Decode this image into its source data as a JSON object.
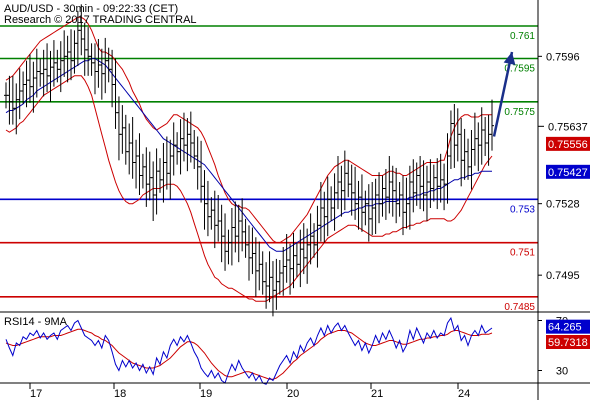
{
  "header": {
    "line1": "AUD/USD - 30min - 09:22:33 (CET)",
    "line2": "Research © 2017 TRADING CENTRAL"
  },
  "rsi_title": "RSI14 - 9MA",
  "colors": {
    "price": "#000000",
    "bollinger": "#cc0000",
    "ma": "#0000aa",
    "resistance": "#008000",
    "support": "#cc0000",
    "pivot": "#0000cc",
    "arrow": "#1a2f8a",
    "rsi": "#0000cc",
    "rsi_ma": "#cc0000"
  },
  "chart_data": [
    {
      "type": "candlestick",
      "x_ticks": [
        "17",
        "18",
        "19",
        "20",
        "21",
        "24"
      ],
      "y_ticks": [
        "0.7596",
        "0.7528",
        "0.7495"
      ],
      "ylim": [
        0.7478,
        0.7622
      ],
      "levels": [
        {
          "label": "0.761",
          "value": 0.761,
          "kind": "resistance"
        },
        {
          "label": "0.7595",
          "value": 0.7595,
          "kind": "resistance"
        },
        {
          "label": "0.7575",
          "value": 0.7575,
          "kind": "resistance"
        },
        {
          "label": "0.753",
          "value": 0.753,
          "kind": "pivot"
        },
        {
          "label": "0.751",
          "value": 0.751,
          "kind": "support"
        },
        {
          "label": "0.7485",
          "value": 0.7485,
          "kind": "support"
        }
      ],
      "value_tags": [
        {
          "label": "0.75637",
          "value": 0.75637,
          "kind": "price"
        },
        {
          "label": "0.75556",
          "value": 0.75556,
          "kind": "bollinger"
        },
        {
          "label": "0.75427",
          "value": 0.75427,
          "kind": "ma"
        }
      ],
      "close": [
        0.7578,
        0.7575,
        0.7572,
        0.7576,
        0.758,
        0.7583,
        0.7585,
        0.7582,
        0.7586,
        0.7589,
        0.7588,
        0.759,
        0.7587,
        0.7591,
        0.7593,
        0.759,
        0.7594,
        0.7596,
        0.7598,
        0.7594,
        0.7602,
        0.7608,
        0.7604,
        0.7599,
        0.7596,
        0.7593,
        0.7589,
        0.7592,
        0.7588,
        0.7594,
        0.759,
        0.7583,
        0.757,
        0.756,
        0.7563,
        0.7552,
        0.7556,
        0.7547,
        0.755,
        0.7541,
        0.7545,
        0.7537,
        0.754,
        0.7532,
        0.7543,
        0.7539,
        0.7547,
        0.7542,
        0.755,
        0.7555,
        0.7552,
        0.7558,
        0.7555,
        0.756,
        0.7556,
        0.755,
        0.7545,
        0.7536,
        0.7528,
        0.7522,
        0.7525,
        0.7518,
        0.752,
        0.7513,
        0.7506,
        0.751,
        0.7517,
        0.7513,
        0.752,
        0.7515,
        0.7509,
        0.7503,
        0.7505,
        0.7497,
        0.75,
        0.7492,
        0.749,
        0.7494,
        0.7488,
        0.7492,
        0.7496,
        0.7499,
        0.7502,
        0.7498,
        0.7504,
        0.75,
        0.7507,
        0.7503,
        0.7509,
        0.7513,
        0.7509,
        0.7518,
        0.7526,
        0.7522,
        0.753,
        0.7526,
        0.7533,
        0.7538,
        0.7534,
        0.7542,
        0.7537,
        0.7533,
        0.7528,
        0.7531,
        0.7524,
        0.7528,
        0.7521,
        0.7526,
        0.7532,
        0.7528,
        0.7535,
        0.7531,
        0.7538,
        0.7534,
        0.7528,
        0.7532,
        0.7524,
        0.7528,
        0.7538,
        0.7533,
        0.7541,
        0.7536,
        0.7532,
        0.7538,
        0.7535,
        0.754,
        0.7536,
        0.7539,
        0.7537,
        0.755,
        0.7565,
        0.7555,
        0.756,
        0.7548,
        0.7552,
        0.7545,
        0.7553,
        0.7558,
        0.7555,
        0.7562,
        0.7556,
        0.756,
        0.7564
      ],
      "ma": [
        0.757,
        0.7571,
        0.7571,
        0.7572,
        0.7573,
        0.7574,
        0.7576,
        0.7577,
        0.7578,
        0.758,
        0.7581,
        0.7582,
        0.7583,
        0.7584,
        0.7585,
        0.7586,
        0.7587,
        0.7588,
        0.7589,
        0.759,
        0.7591,
        0.7592,
        0.7593,
        0.7594,
        0.7594,
        0.7595,
        0.7595,
        0.7594,
        0.7593,
        0.7592,
        0.759,
        0.7588,
        0.7586,
        0.7584,
        0.7582,
        0.758,
        0.7578,
        0.7576,
        0.7574,
        0.7572,
        0.757,
        0.7568,
        0.7566,
        0.7564,
        0.7562,
        0.756,
        0.7558,
        0.7557,
        0.7556,
        0.7555,
        0.7554,
        0.7553,
        0.7552,
        0.7551,
        0.755,
        0.7549,
        0.7548,
        0.7547,
        0.7546,
        0.7544,
        0.7542,
        0.754,
        0.7538,
        0.7536,
        0.7534,
        0.7532,
        0.753,
        0.7528,
        0.7526,
        0.7524,
        0.7522,
        0.752,
        0.7518,
        0.7516,
        0.7514,
        0.7512,
        0.751,
        0.7508,
        0.7507,
        0.7506,
        0.7506,
        0.7506,
        0.7507,
        0.7508,
        0.7509,
        0.751,
        0.7511,
        0.7512,
        0.7513,
        0.7514,
        0.7515,
        0.7516,
        0.7517,
        0.7518,
        0.7519,
        0.752,
        0.7521,
        0.7522,
        0.7523,
        0.7524,
        0.7524,
        0.7525,
        0.7525,
        0.7526,
        0.7526,
        0.7527,
        0.7527,
        0.7527,
        0.7528,
        0.7528,
        0.7528,
        0.7529,
        0.7529,
        0.7529,
        0.7529,
        0.753,
        0.753,
        0.753,
        0.7531,
        0.7531,
        0.7532,
        0.7532,
        0.7533,
        0.7533,
        0.7534,
        0.7534,
        0.7535,
        0.7535,
        0.7536,
        0.7537,
        0.7538,
        0.7539,
        0.7539,
        0.754,
        0.754,
        0.7541,
        0.7541,
        0.7542,
        0.7542,
        0.7543,
        0.7543,
        0.7543,
        0.7543
      ],
      "bb_upper": [
        0.7585,
        0.7586,
        0.7587,
        0.7589,
        0.7591,
        0.7593,
        0.7595,
        0.7597,
        0.7599,
        0.7601,
        0.7603,
        0.7604,
        0.7605,
        0.7606,
        0.7607,
        0.7608,
        0.7609,
        0.761,
        0.7611,
        0.7612,
        0.7613,
        0.7614,
        0.7614,
        0.7613,
        0.7611,
        0.7608,
        0.7604,
        0.76,
        0.7598,
        0.7598,
        0.7597,
        0.7596,
        0.7594,
        0.7592,
        0.759,
        0.7587,
        0.7584,
        0.758,
        0.7577,
        0.7574,
        0.757,
        0.7567,
        0.7565,
        0.7563,
        0.7562,
        0.7563,
        0.7564,
        0.7565,
        0.7567,
        0.7569,
        0.7569,
        0.7568,
        0.7567,
        0.7566,
        0.7565,
        0.7564,
        0.7563,
        0.7561,
        0.7558,
        0.7554,
        0.755,
        0.7546,
        0.7541,
        0.7537,
        0.7533,
        0.753,
        0.7528,
        0.7527,
        0.7527,
        0.7526,
        0.7526,
        0.7525,
        0.7523,
        0.7521,
        0.7519,
        0.7517,
        0.7515,
        0.7513,
        0.7511,
        0.751,
        0.751,
        0.7511,
        0.7512,
        0.7513,
        0.7515,
        0.7517,
        0.7519,
        0.7521,
        0.7523,
        0.7526,
        0.7529,
        0.7532,
        0.7535,
        0.7538,
        0.7541,
        0.7543,
        0.7545,
        0.7546,
        0.7547,
        0.7548,
        0.7548,
        0.7547,
        0.7546,
        0.7545,
        0.7544,
        0.7543,
        0.7542,
        0.7541,
        0.7541,
        0.7541,
        0.7541,
        0.7542,
        0.7543,
        0.7543,
        0.7542,
        0.7542,
        0.7541,
        0.7541,
        0.7542,
        0.7543,
        0.7544,
        0.7545,
        0.7546,
        0.7547,
        0.7547,
        0.7547,
        0.7547,
        0.7548,
        0.7548,
        0.7553,
        0.7559,
        0.7563,
        0.7566,
        0.7568,
        0.7569,
        0.7569,
        0.7568,
        0.7568,
        0.7568,
        0.7569,
        0.7569,
        0.7569,
        0.7569
      ],
      "bb_lower": [
        0.7562,
        0.7561,
        0.7562,
        0.7563,
        0.7565,
        0.7566,
        0.7568,
        0.757,
        0.7572,
        0.7574,
        0.7576,
        0.7578,
        0.7579,
        0.758,
        0.7581,
        0.7582,
        0.7583,
        0.7584,
        0.7585,
        0.7586,
        0.7587,
        0.7587,
        0.7587,
        0.7585,
        0.7582,
        0.7578,
        0.7572,
        0.7566,
        0.756,
        0.7554,
        0.7548,
        0.7543,
        0.7538,
        0.7534,
        0.7531,
        0.7529,
        0.7528,
        0.7528,
        0.7529,
        0.753,
        0.7532,
        0.7533,
        0.7534,
        0.7535,
        0.7535,
        0.7535,
        0.7536,
        0.7537,
        0.7537,
        0.7537,
        0.7536,
        0.7534,
        0.7531,
        0.7528,
        0.7524,
        0.7519,
        0.7514,
        0.7509,
        0.7504,
        0.75,
        0.7497,
        0.7494,
        0.7493,
        0.7491,
        0.749,
        0.7489,
        0.7489,
        0.7488,
        0.7487,
        0.7486,
        0.7485,
        0.7484,
        0.7484,
        0.7483,
        0.7483,
        0.7483,
        0.7483,
        0.7484,
        0.7485,
        0.7486,
        0.7487,
        0.7488,
        0.7489,
        0.749,
        0.7492,
        0.7494,
        0.7496,
        0.7498,
        0.75,
        0.7502,
        0.7504,
        0.7506,
        0.7508,
        0.751,
        0.7512,
        0.7513,
        0.7514,
        0.7515,
        0.7516,
        0.7517,
        0.7518,
        0.7518,
        0.7518,
        0.7517,
        0.7516,
        0.7515,
        0.7514,
        0.7513,
        0.7513,
        0.7513,
        0.7513,
        0.7514,
        0.7514,
        0.7515,
        0.7515,
        0.7516,
        0.7517,
        0.7517,
        0.7518,
        0.7518,
        0.7519,
        0.7519,
        0.752,
        0.752,
        0.7521,
        0.7521,
        0.7521,
        0.7521,
        0.7521,
        0.752,
        0.752,
        0.7521,
        0.7523,
        0.7525,
        0.7528,
        0.7531,
        0.7534,
        0.7537,
        0.754,
        0.7543,
        0.7546,
        0.7548,
        0.755
      ]
    },
    {
      "type": "line",
      "title": "RSI14 - 9MA",
      "ylim": [
        20,
        76
      ],
      "y_ticks": [
        "70",
        "30"
      ],
      "value_tags": [
        {
          "label": "64.265",
          "value": 64.265,
          "kind": "rsi"
        },
        {
          "label": "59.7318",
          "value": 59.7318,
          "kind": "rsi_ma"
        }
      ],
      "rsi": [
        55,
        48,
        42,
        52,
        50,
        57,
        55,
        60,
        58,
        62,
        56,
        60,
        55,
        58,
        60,
        55,
        62,
        64,
        66,
        62,
        68,
        70,
        64,
        58,
        56,
        54,
        50,
        54,
        48,
        58,
        54,
        45,
        35,
        30,
        38,
        33,
        38,
        32,
        36,
        30,
        35,
        28,
        33,
        27,
        40,
        35,
        45,
        40,
        50,
        55,
        50,
        57,
        53,
        58,
        52,
        45,
        40,
        32,
        28,
        25,
        30,
        24,
        28,
        22,
        20,
        28,
        35,
        30,
        38,
        32,
        28,
        24,
        28,
        22,
        26,
        20,
        19,
        24,
        22,
        28,
        34,
        38,
        42,
        36,
        45,
        40,
        50,
        45,
        52,
        56,
        50,
        58,
        64,
        58,
        66,
        60,
        65,
        68,
        62,
        66,
        60,
        55,
        50,
        54,
        46,
        52,
        44,
        50,
        58,
        52,
        60,
        55,
        62,
        56,
        48,
        54,
        45,
        50,
        62,
        55,
        64,
        58,
        52,
        60,
        56,
        62,
        56,
        60,
        58,
        68,
        72,
        62,
        66,
        54,
        58,
        50,
        58,
        62,
        58,
        66,
        60,
        62,
        64
      ],
      "rsi_ma": [
        52,
        51,
        50,
        50,
        51,
        52,
        53,
        54,
        55,
        56,
        57,
        57,
        57,
        57,
        58,
        58,
        58,
        59,
        60,
        61,
        62,
        63,
        63,
        62,
        61,
        60,
        58,
        57,
        55,
        54,
        52,
        50,
        47,
        44,
        42,
        40,
        38,
        36,
        35,
        34,
        33,
        32,
        32,
        32,
        33,
        34,
        36,
        38,
        40,
        43,
        46,
        49,
        51,
        53,
        53,
        52,
        50,
        47,
        44,
        40,
        36,
        33,
        30,
        28,
        26,
        25,
        25,
        26,
        27,
        28,
        29,
        29,
        28,
        27,
        26,
        25,
        24,
        23,
        23,
        24,
        26,
        28,
        31,
        34,
        37,
        39,
        42,
        44,
        46,
        48,
        50,
        52,
        55,
        57,
        59,
        60,
        61,
        62,
        62,
        62,
        61,
        60,
        58,
        56,
        54,
        52,
        51,
        50,
        50,
        51,
        52,
        53,
        54,
        54,
        53,
        52,
        51,
        51,
        52,
        53,
        54,
        55,
        55,
        56,
        56,
        57,
        57,
        58,
        58,
        59,
        61,
        62,
        62,
        61,
        60,
        59,
        58,
        58,
        58,
        59,
        59,
        59,
        60
      ]
    }
  ]
}
